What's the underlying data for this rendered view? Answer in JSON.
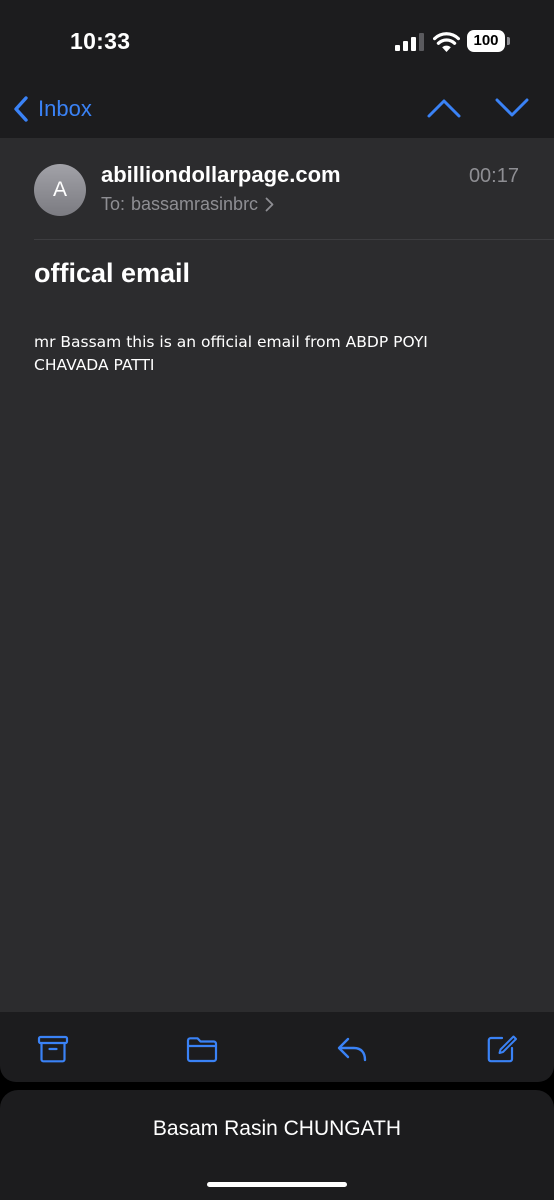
{
  "status_bar": {
    "time": "10:33",
    "battery": "100",
    "icons": [
      "signal-icon",
      "wifi-icon",
      "battery-icon"
    ]
  },
  "nav": {
    "back_label": "Inbox",
    "icons": [
      "chevron-left-icon",
      "chevron-up-icon",
      "chevron-down-icon"
    ]
  },
  "email": {
    "avatar_initial": "A",
    "sender": "abilliondollarpage.com",
    "time": "00:17",
    "to_label": "To:",
    "recipient": "bassamrasinbrc",
    "subject": "offical email",
    "body": "mr Bassam this is an official email from ABDP POYI CHAVADA PATTI"
  },
  "toolbar": {
    "icons": [
      "archive-icon",
      "folder-icon",
      "reply-icon",
      "compose-icon"
    ]
  },
  "account": {
    "name": "Basam Rasin CHUNGATH"
  },
  "colors": {
    "accent": "#3a82f6",
    "background": "#2c2c2e",
    "bar": "#1c1c1e",
    "secondary_text": "#8e8e93"
  }
}
